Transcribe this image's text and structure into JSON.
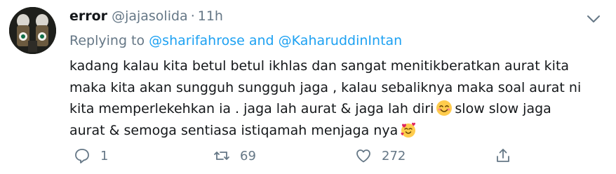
{
  "tweet": {
    "author_name": "error",
    "handle": "@jajasolida",
    "separator": "·",
    "time": "11h",
    "replying_prefix": "Replying to",
    "mention_1": "@sharifahrose",
    "and_word": "and",
    "mention_2": "@KaharuddinIntan",
    "lines": [
      "kadang kalau kita betul betul ikhlas dan sangat menitikberatkan aurat kita",
      "maka kita akan sungguh sungguh jaga , kalau sebaliknya maka soal aurat ni",
      "kita memperlekehkan ia . jaga lah aurat & jaga lah diri",
      "slow slow jaga",
      "aurat & semoga sentiasa istiqamah menjaga nya"
    ],
    "emoji_1": "smiling-face-with-smiling-eyes",
    "emoji_2": "smiling-face-with-hearts"
  },
  "actions": {
    "reply_count": "1",
    "retweet_count": "69",
    "like_count": "272",
    "share_icon": "share-icon"
  },
  "colors": {
    "text": "#14171a",
    "secondary": "#657786",
    "link": "#1da1f2"
  }
}
